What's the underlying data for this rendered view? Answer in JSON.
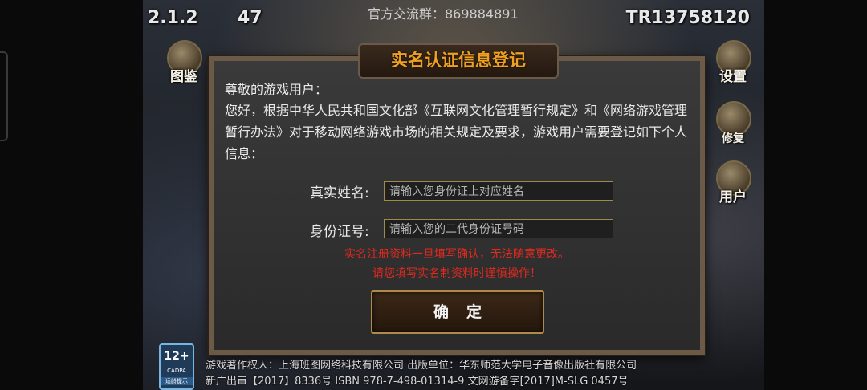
{
  "hud": {
    "version": "2.1.2",
    "counter": "47",
    "qq_group": "官方交流群：869884891",
    "player_id": "TR13758120",
    "buttons": {
      "encyclopedia": "图鉴",
      "settings": "设置",
      "repair": "修复",
      "user": "用户"
    }
  },
  "dialog": {
    "title": "实名认证信息登记",
    "greeting": "尊敬的游戏用户：",
    "intro": "您好，根据中华人民共和国文化部《互联网文化管理暂行规定》和《网络游戏管理暂行办法》对于移动网络游戏市场的相关规定及要求，游戏用户需要登记如下个人信息：",
    "name_label": "真实姓名:",
    "name_placeholder": "请输入您身份证上对应姓名",
    "id_label": "身份证号:",
    "id_placeholder": "请输入您的二代身份证号码",
    "warning_1": "实名注册资料一旦填写确认，无法随意更改。",
    "warning_2": "请您填写实名制资料时谨慎操作！",
    "confirm": "确定"
  },
  "footer": {
    "age_rating": "12+",
    "age_org": "CADPA",
    "age_tip": "适龄提示",
    "line1": "游戏著作权人：上海班图网络科技有限公司  出版单位：华东师范大学电子音像出版社有限公司",
    "line2": "新广出审【2017】8336号      ISBN 978-7-498-01314-9      文网游备字[2017]M-SLG 0457号"
  },
  "colors": {
    "title_accent": "#f0a020",
    "warning": "#e0291f",
    "frame": "#6b5a48"
  }
}
